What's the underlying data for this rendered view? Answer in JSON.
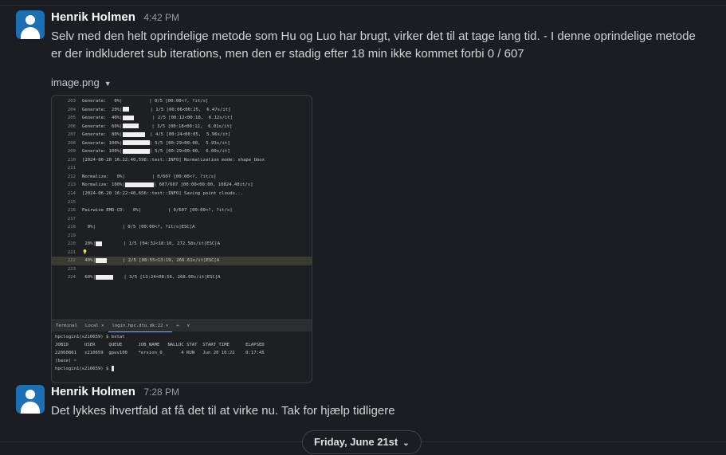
{
  "messages": [
    {
      "author": "Henrik Holmen",
      "time": "4:42 PM",
      "text": "Selv med den helt oprindelige metode som Hu og Luo har brugt, virker det til at tage lang tid. - I denne oprindelige metode er der indkluderet sub iterations, men den er stadig efter 18 min ikke kommet forbi 0 / 607",
      "attachment": "image.png"
    },
    {
      "author": "Henrik Holmen",
      "time": "7:28 PM",
      "text": "Det lykkes ihvertfald at få det til at virke nu. Tak for hjælp tidligere"
    }
  ],
  "screenshot": {
    "code_lines": [
      {
        "n": "203",
        "pre": "Generate:   0%|",
        "bar": 0,
        "post": "          | 0/5 [00:00<?, ?it/s]"
      },
      {
        "n": "204",
        "pre": "Generate:  20%|",
        "bar": 8,
        "post": "        | 1/5 [00:06<00:25,  6.47s/it]"
      },
      {
        "n": "205",
        "pre": "Generate:  40%|",
        "bar": 14,
        "post": "       | 2/5 [00:12<00:18,  6.12s/it]"
      },
      {
        "n": "206",
        "pre": "Generate:  60%|",
        "bar": 20,
        "post": "     | 3/5 [00:18<00:12,  6.01s/it]"
      },
      {
        "n": "207",
        "pre": "Generate:  80%|",
        "bar": 28,
        "post": "  | 4/5 [00:24<00:05,  5.96s/it]"
      },
      {
        "n": "208",
        "pre": "Generate: 100%|",
        "bar": 34,
        "post": "| 5/5 [00:29<00:00,  5.93s/it]"
      },
      {
        "n": "209",
        "pre": "Generate: 100%|",
        "bar": 34,
        "post": "| 5/5 [00:29<00:00,  6.00s/it]"
      },
      {
        "n": "210",
        "pre": "[2024-06-20 16:22:40,598::test::INFO] Normalization mode: shape_bbox",
        "bar": 0,
        "post": ""
      },
      {
        "n": "211",
        "pre": "",
        "bar": 0,
        "post": ""
      },
      {
        "n": "212",
        "pre": "Normalize:   0%|",
        "bar": 0,
        "post": "          | 0/607 [00:00<?, ?it/s]"
      },
      {
        "n": "213",
        "pre": "Normalize: 100%|",
        "bar": 36,
        "post": "| 607/607 [00:00<00:00, 10824.48it/s]"
      },
      {
        "n": "214",
        "pre": "[2024-06-20 16:22:40,656::test::INFO] Saving point clouds...",
        "bar": 0,
        "post": ""
      },
      {
        "n": "215",
        "pre": "",
        "bar": 0,
        "post": ""
      },
      {
        "n": "216",
        "pre": "Pairwise EMD-CD:   0%|",
        "bar": 0,
        "post": "          | 0/607 [00:00<?, ?it/s]"
      },
      {
        "n": "217",
        "pre": "",
        "bar": 0,
        "post": ""
      },
      {
        "n": "218",
        "pre": "  0%|",
        "bar": 0,
        "post": "          | 0/5 [00:00<?, ?it/s]ESC[A"
      },
      {
        "n": "219",
        "pre": "",
        "bar": 0,
        "post": ""
      },
      {
        "n": "220",
        "pre": " 20%|",
        "bar": 8,
        "post": "        | 1/5 [04:32<18:10, 272.58s/it]ESC[A"
      },
      {
        "n": "221",
        "pre": "💡",
        "bar": 0,
        "post": ""
      },
      {
        "n": "222",
        "pre": " 40%|",
        "bar": 14,
        "post": "      | 2/5 [08:55<13:19, 266.61s/it]ESC[A"
      },
      {
        "n": "223",
        "pre": "",
        "bar": 0,
        "post": ""
      },
      {
        "n": "224",
        "pre": " 60%|",
        "bar": 22,
        "post": "    | 3/5 [13:24<08:56, 268.00s/it]ESC[A"
      }
    ],
    "terminal_tabs": [
      "Terminal",
      "Local ×",
      "login.hpc.dtu.dk:22 ×",
      "+",
      "∨"
    ],
    "terminal_lines": [
      "hpclogin1(s210659) $ bstat",
      "JOBID      USER     QUEUE      JOB_NAME   NALLOC STAT  START_TIME      ELAPSED",
      "22060861   s210659  gpuv100    *ersion_0_      4 RUN   Jun 20 16:22    0:17:45",
      "(base) ~",
      "hpclogin1(s210659) $ "
    ]
  },
  "date_divider": "Friday, June 21st"
}
